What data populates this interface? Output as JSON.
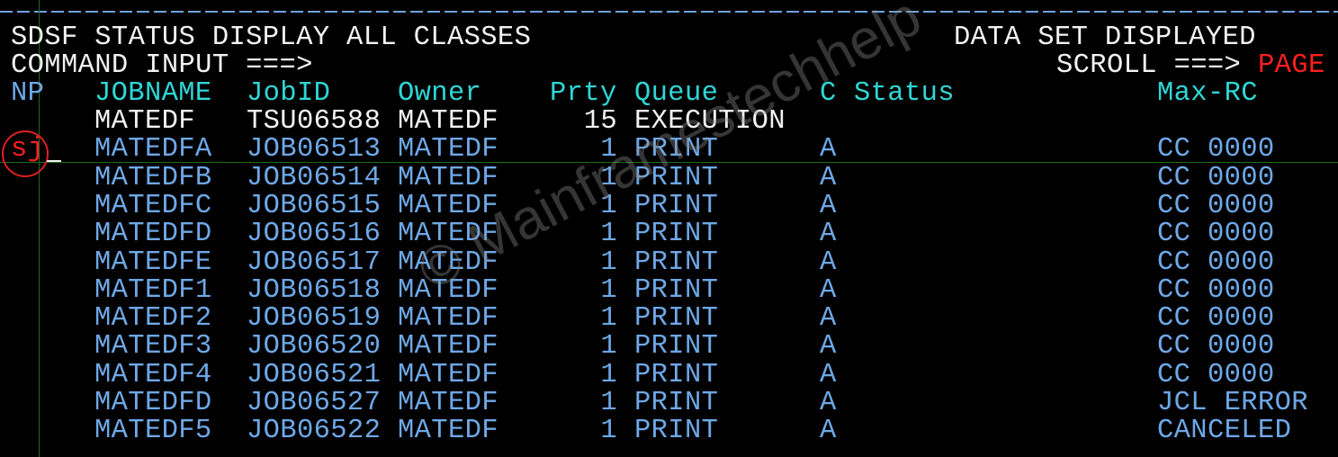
{
  "header": {
    "title": "SDSF STATUS DISPLAY ALL CLASSES",
    "status_message": "DATA SET DISPLAYED",
    "command_label": "COMMAND INPUT ===>",
    "command_value": "",
    "scroll_label": "SCROLL ===>",
    "scroll_value": "PAGE"
  },
  "columns": {
    "np": "NP",
    "jobname": "JOBNAME",
    "jobid": "JobID",
    "owner": "Owner",
    "prty": "Prty",
    "queue": "Queue",
    "c": "C",
    "status": "Status",
    "maxrc": "Max-RC"
  },
  "rows": [
    {
      "np": "",
      "jobname": "MATEDF",
      "jobid": "TSU06588",
      "owner": "MATEDF",
      "prty": "15",
      "queue": "EXECUTION",
      "c": "",
      "status": "",
      "maxrc": ""
    },
    {
      "np": "sj",
      "jobname": "MATEDFA",
      "jobid": "JOB06513",
      "owner": "MATEDF",
      "prty": "1",
      "queue": "PRINT",
      "c": "A",
      "status": "",
      "maxrc": "CC 0000"
    },
    {
      "np": "",
      "jobname": "MATEDFB",
      "jobid": "JOB06514",
      "owner": "MATEDF",
      "prty": "1",
      "queue": "PRINT",
      "c": "A",
      "status": "",
      "maxrc": "CC 0000"
    },
    {
      "np": "",
      "jobname": "MATEDFC",
      "jobid": "JOB06515",
      "owner": "MATEDF",
      "prty": "1",
      "queue": "PRINT",
      "c": "A",
      "status": "",
      "maxrc": "CC 0000"
    },
    {
      "np": "",
      "jobname": "MATEDFD",
      "jobid": "JOB06516",
      "owner": "MATEDF",
      "prty": "1",
      "queue": "PRINT",
      "c": "A",
      "status": "",
      "maxrc": "CC 0000"
    },
    {
      "np": "",
      "jobname": "MATEDFE",
      "jobid": "JOB06517",
      "owner": "MATEDF",
      "prty": "1",
      "queue": "PRINT",
      "c": "A",
      "status": "",
      "maxrc": "CC 0000"
    },
    {
      "np": "",
      "jobname": "MATEDF1",
      "jobid": "JOB06518",
      "owner": "MATEDF",
      "prty": "1",
      "queue": "PRINT",
      "c": "A",
      "status": "",
      "maxrc": "CC 0000"
    },
    {
      "np": "",
      "jobname": "MATEDF2",
      "jobid": "JOB06519",
      "owner": "MATEDF",
      "prty": "1",
      "queue": "PRINT",
      "c": "A",
      "status": "",
      "maxrc": "CC 0000"
    },
    {
      "np": "",
      "jobname": "MATEDF3",
      "jobid": "JOB06520",
      "owner": "MATEDF",
      "prty": "1",
      "queue": "PRINT",
      "c": "A",
      "status": "",
      "maxrc": "CC 0000"
    },
    {
      "np": "",
      "jobname": "MATEDF4",
      "jobid": "JOB06521",
      "owner": "MATEDF",
      "prty": "1",
      "queue": "PRINT",
      "c": "A",
      "status": "",
      "maxrc": "CC 0000"
    },
    {
      "np": "",
      "jobname": "MATEDFD",
      "jobid": "JOB06527",
      "owner": "MATEDF",
      "prty": "1",
      "queue": "PRINT",
      "c": "A",
      "status": "",
      "maxrc": "JCL ERROR"
    },
    {
      "np": "",
      "jobname": "MATEDF5",
      "jobid": "JOB06522",
      "owner": "MATEDF",
      "prty": "1",
      "queue": "PRINT",
      "c": "A",
      "status": "",
      "maxrc": "CANCELED"
    }
  ],
  "watermark": "© Mainframestechhelp",
  "colors": {
    "background": "#000000",
    "header_text": "#f2f2f2",
    "column_header": "#2fd6d6",
    "row_text": "#6ea8e6",
    "highlight": "#ff1f1f"
  }
}
